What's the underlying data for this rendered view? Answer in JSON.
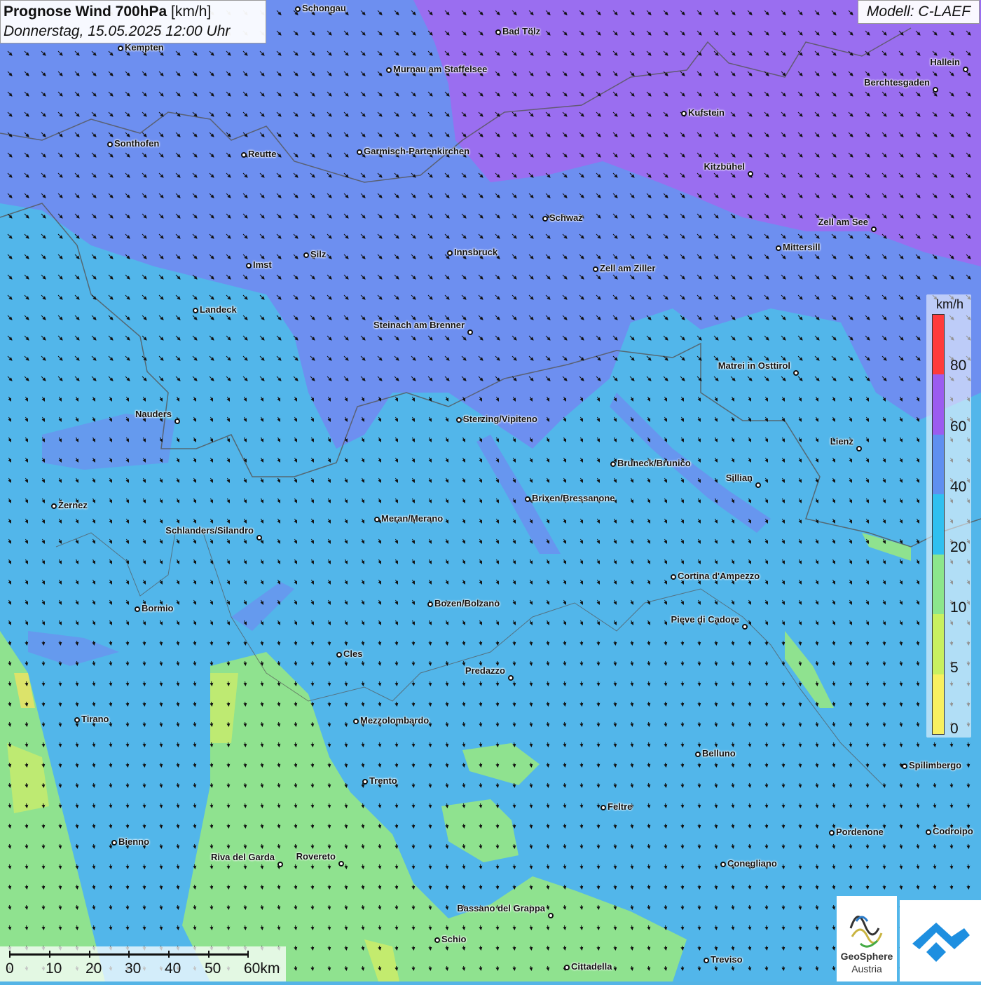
{
  "title": {
    "main": "Prognose Wind 700hPa",
    "unit": "[km/h]",
    "datetime": "Donnerstag, 15.05.2025 12:00 Uhr"
  },
  "model": "Modell: C-LAEF",
  "legend": {
    "unit": "km/h",
    "labels": [
      "80",
      "60",
      "40",
      "20",
      "10",
      "5",
      "0"
    ],
    "colors": [
      "#ff3b3b",
      "#9b5cf0",
      "#5f8ff0",
      "#2fc0f0",
      "#8ce68c",
      "#c8f060",
      "#f8f060"
    ]
  },
  "scalebar": {
    "labels": [
      "0",
      "10",
      "20",
      "30",
      "40",
      "50",
      "60km"
    ]
  },
  "logos": {
    "geosphere_line1": "GeoSphere",
    "geosphere_line2": "Austria"
  },
  "cities": [
    {
      "name": "Schongau"
    },
    {
      "name": "Bad Tölz"
    },
    {
      "name": "Kempten"
    },
    {
      "name": "Murnau am Staffelsee"
    },
    {
      "name": "Hallein"
    },
    {
      "name": "Berchtesgaden"
    },
    {
      "name": "Kufstein"
    },
    {
      "name": "Sonthofen"
    },
    {
      "name": "Reutte"
    },
    {
      "name": "Garmisch-Partenkirchen"
    },
    {
      "name": "Kitzbühel"
    },
    {
      "name": "Schwaz"
    },
    {
      "name": "Zell am See"
    },
    {
      "name": "Mittersill"
    },
    {
      "name": "Silz"
    },
    {
      "name": "Innsbruck"
    },
    {
      "name": "Imst"
    },
    {
      "name": "Zell am Ziller"
    },
    {
      "name": "Landeck"
    },
    {
      "name": "Steinach am Brenner"
    },
    {
      "name": "Matrei in Osttirol"
    },
    {
      "name": "Nauders"
    },
    {
      "name": "Sterzing/Vipiteno"
    },
    {
      "name": "Lienz"
    },
    {
      "name": "Bruneck/Brunico"
    },
    {
      "name": "Sillian"
    },
    {
      "name": "Zernez"
    },
    {
      "name": "Brixen/Bressanone"
    },
    {
      "name": "Meran/Merano"
    },
    {
      "name": "Schlanders/Silandro"
    },
    {
      "name": "Cortina d'Ampezzo"
    },
    {
      "name": "Bormio"
    },
    {
      "name": "Bozen/Bolzano"
    },
    {
      "name": "Pieve di Cadore"
    },
    {
      "name": "Cles"
    },
    {
      "name": "Predazzo"
    },
    {
      "name": "Tirano"
    },
    {
      "name": "Mezzolombardo"
    },
    {
      "name": "Belluno"
    },
    {
      "name": "Spilimbergo"
    },
    {
      "name": "Trento"
    },
    {
      "name": "Feltre"
    },
    {
      "name": "Bienno"
    },
    {
      "name": "Pordenone"
    },
    {
      "name": "Codroipo"
    },
    {
      "name": "Riva del Garda"
    },
    {
      "name": "Rovereto"
    },
    {
      "name": "Conegliano"
    },
    {
      "name": "Bassano del Grappa"
    },
    {
      "name": "Schio"
    },
    {
      "name": "Treviso"
    },
    {
      "name": "Cittadella"
    }
  ]
}
